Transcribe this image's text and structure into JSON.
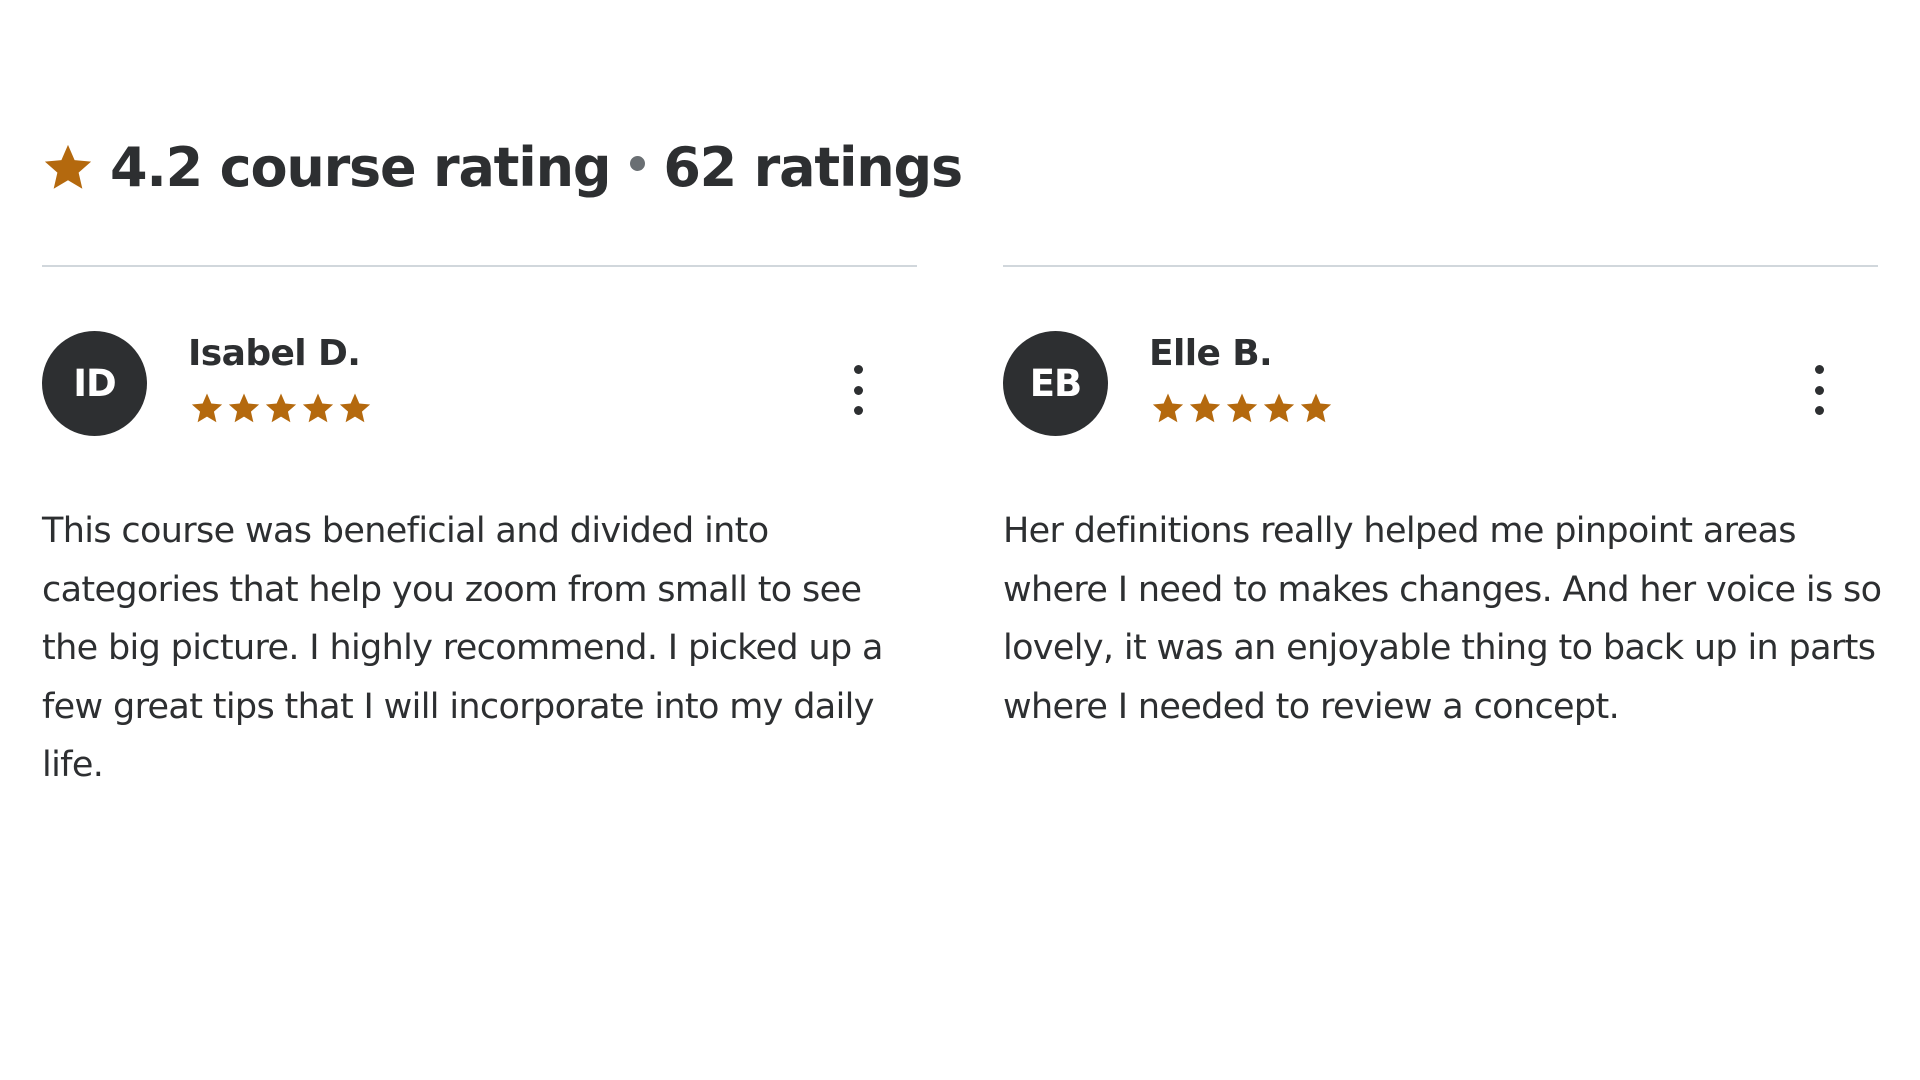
{
  "summary": {
    "star_icon": "star-icon",
    "rating_text": "4.2 course rating",
    "count_text": "62 ratings",
    "accent_color": "#b4690e"
  },
  "reviews": [
    {
      "initials": "ID",
      "name": "Isabel D.",
      "stars": 5,
      "text": "This course was beneficial and divided into categories that help you zoom from small to see the big picture. I highly recommend. I picked up a few great tips that I will incorporate into my daily life.",
      "menu_icon": "more-vertical-icon"
    },
    {
      "initials": "EB",
      "name": "Elle B.",
      "stars": 5,
      "text": "Her definitions really helped me pinpoint areas where I need to makes changes. And her voice is so lovely, it was an enjoyable thing to back up in parts where I needed to review a concept.",
      "menu_icon": "more-vertical-icon"
    }
  ]
}
